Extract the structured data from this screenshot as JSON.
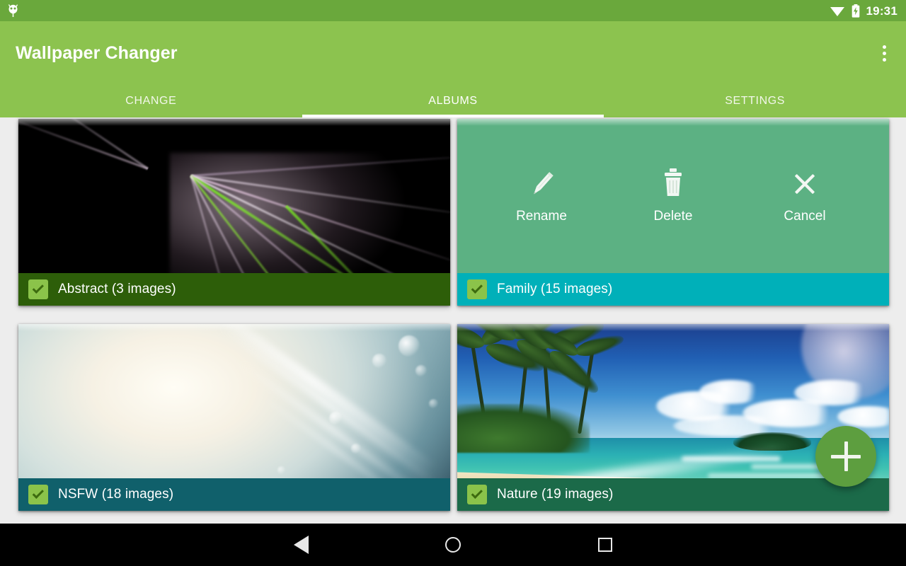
{
  "status_bar": {
    "notification_icon": "android-robot-icon",
    "wifi_icon": "wifi-icon",
    "battery_icon": "battery-charging-icon",
    "time": "19:31",
    "background_color": "#6aa83c"
  },
  "app_bar": {
    "title": "Wallpaper Changer",
    "overflow_icon": "overflow-menu-icon",
    "background_color": "#8cc34f"
  },
  "tabs": {
    "items": [
      {
        "label": "CHANGE",
        "selected": false
      },
      {
        "label": "ALBUMS",
        "selected": true
      },
      {
        "label": "SETTINGS",
        "selected": false
      }
    ],
    "indicator_color": "#ffffff"
  },
  "albums": [
    {
      "name": "Abstract (3 images)",
      "checked": true,
      "label_color": "#2d5e09",
      "thumbnail": "abstract-fractal-thumbnail",
      "actions_visible": false
    },
    {
      "name": "Family (15 images)",
      "checked": true,
      "label_color": "#00b0b9",
      "thumbnail": "family-thumbnail",
      "actions_visible": true
    },
    {
      "name": "NSFW (18 images)",
      "checked": true,
      "label_color": "#10606b",
      "thumbnail": "light-rays-thumbnail",
      "actions_visible": false
    },
    {
      "name": "Nature (19 images)",
      "checked": true,
      "label_color": "#1b6a49",
      "thumbnail": "tropical-beach-thumbnail",
      "actions_visible": false
    }
  ],
  "album_actions": {
    "overlay_color": "#5cb183",
    "rename": {
      "label": "Rename",
      "icon": "pencil-icon"
    },
    "delete": {
      "label": "Delete",
      "icon": "trash-icon"
    },
    "cancel": {
      "label": "Cancel",
      "icon": "close-x-icon"
    }
  },
  "fab": {
    "icon": "plus-icon",
    "color": "#5d9e3f"
  },
  "nav_bar": {
    "back_icon": "back-triangle-icon",
    "home_icon": "home-circle-icon",
    "recents_icon": "recents-square-icon",
    "background_color": "#000000"
  }
}
